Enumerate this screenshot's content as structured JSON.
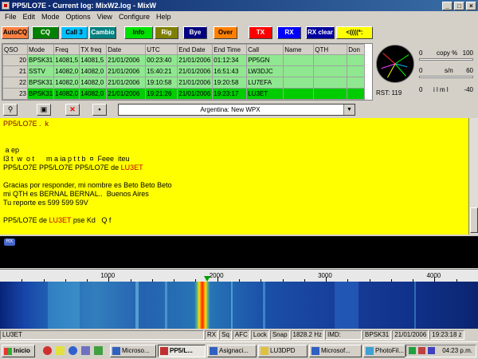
{
  "window": {
    "title": "PP5/LO7E - Current log: MixW2.log - MixW"
  },
  "menu": [
    "File",
    "Edit",
    "Mode",
    "Options",
    "View",
    "Configure",
    "Help"
  ],
  "macro_buttons": [
    {
      "label": "AutoCQ",
      "bg": "#ff8040",
      "color": "#000000"
    },
    {
      "label": "CQ",
      "bg": "#008000",
      "color": "#ffffff"
    },
    {
      "label": "Call 3",
      "bg": "#00c0ff",
      "color": "#000000"
    },
    {
      "label": "Cambio",
      "bg": "#008080",
      "color": "#ffffff"
    },
    {
      "label": "Info",
      "bg": "#00e000",
      "color": "#000000"
    },
    {
      "label": "Rig",
      "bg": "#808000",
      "color": "#ffffff"
    },
    {
      "label": "Bye",
      "bg": "#000080",
      "color": "#ffffff"
    },
    {
      "label": "Over",
      "bg": "#ff8000",
      "color": "#000000"
    },
    {
      "label": "TX",
      "bg": "#ff0000",
      "color": "#ffffff"
    },
    {
      "label": "RX",
      "bg": "#0000ff",
      "color": "#ffffff"
    },
    {
      "label": "RX clear",
      "bg": "#0000a0",
      "color": "#ffffff"
    },
    {
      "label": "<((((*:",
      "bg": "#ffff00",
      "color": "#000000"
    }
  ],
  "qso_table": {
    "columns": [
      "QSO",
      "Mode",
      "Freq",
      "TX freq",
      "Date",
      "UTC",
      "End Date",
      "End Time",
      "Call",
      "Name",
      "QTH",
      "Don"
    ],
    "rows": [
      {
        "qso": "20",
        "mode": "BPSK31",
        "freq": "14081,5",
        "txfreq": "14081,5",
        "date": "21/01/2006",
        "utc": "00:23:40",
        "end_date": "21/01/2006",
        "end_time": "01:12:34",
        "call": "PP5GN"
      },
      {
        "qso": "21",
        "mode": "SSTV",
        "freq": "14082,0",
        "txfreq": "14082,0",
        "date": "21/01/2006",
        "utc": "15:40:21",
        "end_date": "21/01/2006",
        "end_time": "16:51:43",
        "call": "LW3DJC"
      },
      {
        "qso": "22",
        "mode": "BPSK31",
        "freq": "14082,0",
        "txfreq": "14082,0",
        "date": "21/01/2006",
        "utc": "19:10:58",
        "end_date": "21/01/2006",
        "end_time": "19:20:58",
        "call": "LU7EFA"
      },
      {
        "qso": "23",
        "mode": "BPSK31",
        "freq": "14082,0",
        "txfreq": "14082,0",
        "date": "21/01/2006",
        "utc": "19:21:26",
        "end_date": "21/01/2006",
        "end_time": "19:23:17",
        "call": "LU3ET"
      }
    ]
  },
  "meters": {
    "copy": {
      "min": "0",
      "label": "copy %",
      "max": "100"
    },
    "sn": {
      "min": "0",
      "label": "s/n",
      "max": "60"
    },
    "ilm": {
      "min": "0",
      "label": "i l m l",
      "max": "-40"
    },
    "rst": "RST: 119"
  },
  "contest": {
    "selected": "Argentina:  New WPX"
  },
  "rx_text": [
    [
      {
        "t": "PP5/LO7E .  k",
        "c": "dark"
      }
    ],
    [
      {
        "t": ""
      }
    ],
    [
      {
        "t": ""
      }
    ],
    [
      {
        "t": " a ep"
      }
    ],
    [
      {
        "t": "I3 t  w  o t      m a ia p t t b  ¤  Feee  iteu"
      }
    ],
    [
      {
        "t": "PP5/LO7E PP5/LO7E PP5/LO7E de "
      },
      {
        "t": "LU3ET",
        "c": "red"
      }
    ],
    [
      {
        "t": ""
      }
    ],
    [
      {
        "t": "Gracias por responder, mi nombre es Beto Beto Beto"
      }
    ],
    [
      {
        "t": "mi QTH es BERNAL BERNAL..  Buenos Aires"
      }
    ],
    [
      {
        "t": "Tu reporte es 599 599 59V"
      }
    ],
    [
      {
        "t": ""
      }
    ],
    [
      {
        "t": "PP5/LO7E de "
      },
      {
        "t": "LU3ET",
        "c": "red"
      },
      {
        "t": " pse Kd   Q f"
      }
    ]
  ],
  "tx_badge": "RX",
  "ruler": {
    "min": 0,
    "max": 4400,
    "labels": [
      "1000",
      "2000",
      "3000",
      "4000"
    ],
    "label_values": [
      1000,
      2000,
      3000,
      4000
    ]
  },
  "status": {
    "call": "LU3ET",
    "rx": "RX",
    "sq": "Sq",
    "afc": "AFC",
    "lock": "Lock",
    "snap": "Snap",
    "freq": "1828.2 Hz",
    "imd": "IMD:",
    "mode": "BPSK31",
    "date": "21/01/2006",
    "time": "19:23:18 z"
  },
  "taskbar": {
    "start": "Inicio",
    "tasks": [
      "Microso...",
      "PP5/L...",
      "Asignaci...",
      "LU3DPD",
      "Microsof...",
      "PhotoFil..."
    ],
    "active_task": 1,
    "clock": "04:23 p.m."
  }
}
